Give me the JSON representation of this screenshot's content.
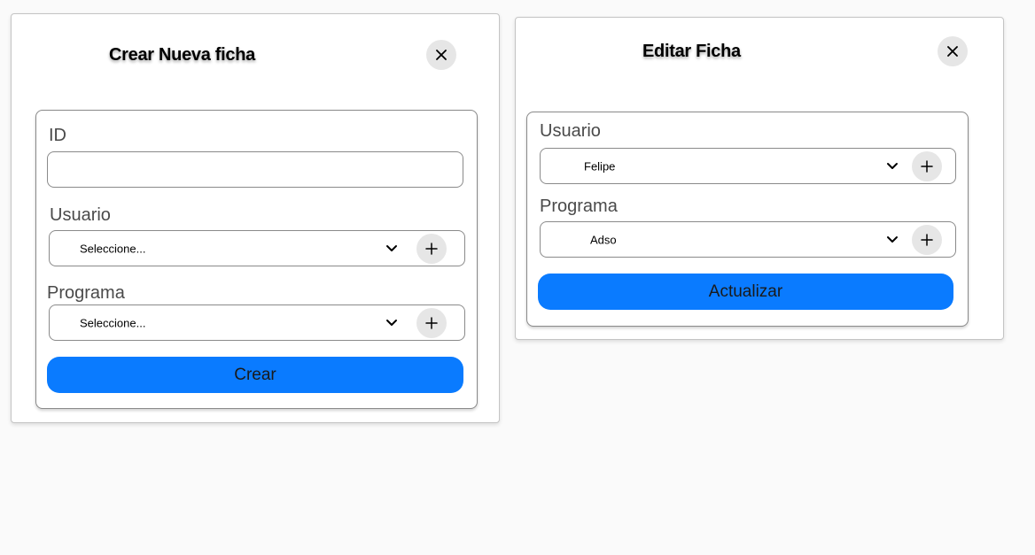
{
  "create_modal": {
    "title": "Crear Nueva ficha",
    "close_icon": "close-icon",
    "id_label": "ID",
    "id_value": "",
    "usuario_label": "Usuario",
    "usuario_value": "Seleccione...",
    "programa_label": "Programa",
    "programa_value": "Seleccione...",
    "submit_label": "Crear"
  },
  "edit_modal": {
    "title": "Editar Ficha",
    "close_icon": "close-icon",
    "usuario_label": "Usuario",
    "usuario_value": "Felipe",
    "programa_label": "Programa",
    "programa_value": "Adso",
    "submit_label": "Actualizar"
  },
  "colors": {
    "primary": "#0a7bff",
    "background": "#fafafa",
    "icon_button_bg": "#e6e6e6"
  }
}
